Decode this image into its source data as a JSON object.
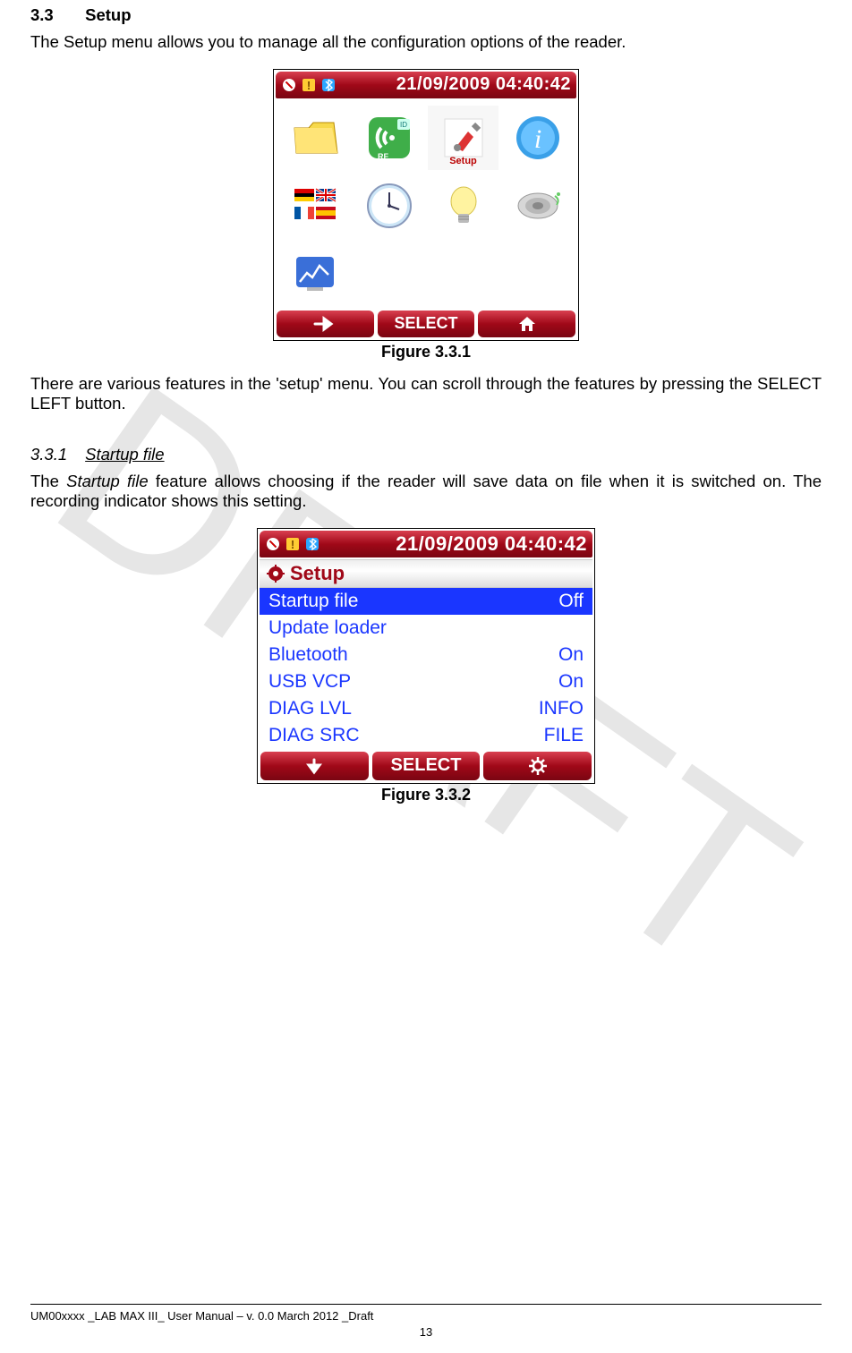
{
  "section": {
    "number": "3.3",
    "title": "Setup",
    "intro": "The Setup menu allows you to manage all the configuration options of the reader."
  },
  "figure1": {
    "caption": "Figure 3.3.1",
    "status_datetime": "21/09/2009 04:40:42",
    "selected_label": "Setup",
    "icons": {
      "folder": "folder-icon",
      "rfid": "rfid-icon",
      "setup": "setup-wrench-icon",
      "info": "info-icon",
      "language": "language-flags-icon",
      "clock": "clock-icon",
      "bulb": "lightbulb-icon",
      "speaker": "speaker-icon",
      "chart": "chart-icon"
    },
    "buttons": {
      "left_glyph": "→",
      "middle": "SELECT",
      "right_glyph": "⌂"
    }
  },
  "para2": "There are various features in the 'setup' menu. You can scroll through the features by pressing the SELECT LEFT button.",
  "subsection": {
    "number": "3.3.1",
    "title": "Startup file",
    "text_a": "The ",
    "text_em": "Startup file",
    "text_b": " feature allows choosing if the reader will save data on file when it is switched on. The recording indicator shows this setting."
  },
  "figure2": {
    "caption": "Figure 3.3.2",
    "status_datetime": "21/09/2009 04:40:42",
    "title_icon": "gear-icon",
    "title": "Setup",
    "rows": [
      {
        "label": "Startup file",
        "value": "Off",
        "selected": true
      },
      {
        "label": "Update loader",
        "value": "",
        "selected": false
      },
      {
        "label": "Bluetooth",
        "value": "On",
        "selected": false
      },
      {
        "label": "USB VCP",
        "value": "On",
        "selected": false
      },
      {
        "label": "DIAG LVL",
        "value": "INFO",
        "selected": false
      },
      {
        "label": "DIAG SRC",
        "value": "FILE",
        "selected": false
      }
    ],
    "buttons": {
      "left_glyph": "↓",
      "middle": "SELECT",
      "right_glyph": "✿"
    }
  },
  "watermark": "DRAFT",
  "footer": "UM00xxxx _LAB MAX III_ User Manual – v. 0.0 March 2012 _Draft",
  "page_number": "13"
}
